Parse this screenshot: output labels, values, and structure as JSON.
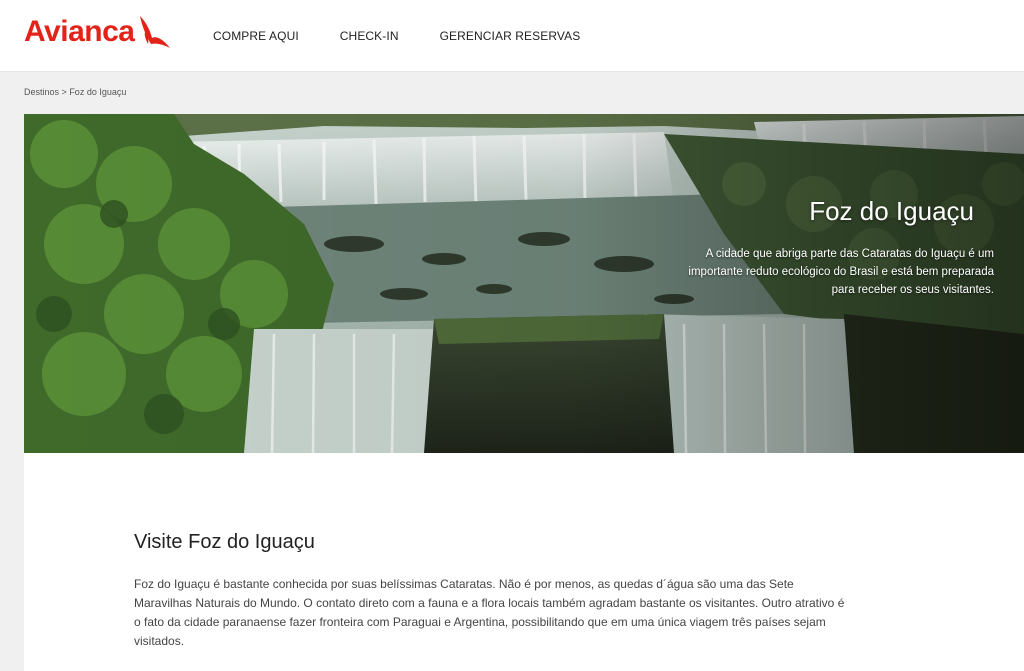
{
  "brand": {
    "name": "Avianca",
    "color": "#e2231a"
  },
  "nav": {
    "items": [
      {
        "label": "COMPRE AQUI"
      },
      {
        "label": "CHECK-IN"
      },
      {
        "label": "GERENCIAR RESERVAS"
      }
    ]
  },
  "breadcrumb": {
    "parent": "Destinos",
    "separator": ">",
    "current": "Foz do Iguaçu"
  },
  "hero": {
    "title": "Foz do Iguaçu",
    "subtitle": "A cidade que abriga parte das Cataratas do Iguaçu é um importante reduto ecológico do Brasil e está bem preparada para receber os seus visitantes."
  },
  "content": {
    "title": "Visite Foz do Iguaçu",
    "body": "Foz do Iguaçu é bastante conhecida por suas belíssimas Cataratas. Não é por menos, as quedas d´água são uma das Sete Maravilhas Naturais do Mundo. O contato direto com a fauna e a flora locais também agradam bastante os visitantes. Outro atrativo é o fato da cidade paranaense fazer fronteira com Paraguai e Argentina, possibilitando que em uma única viagem três países sejam visitados."
  }
}
